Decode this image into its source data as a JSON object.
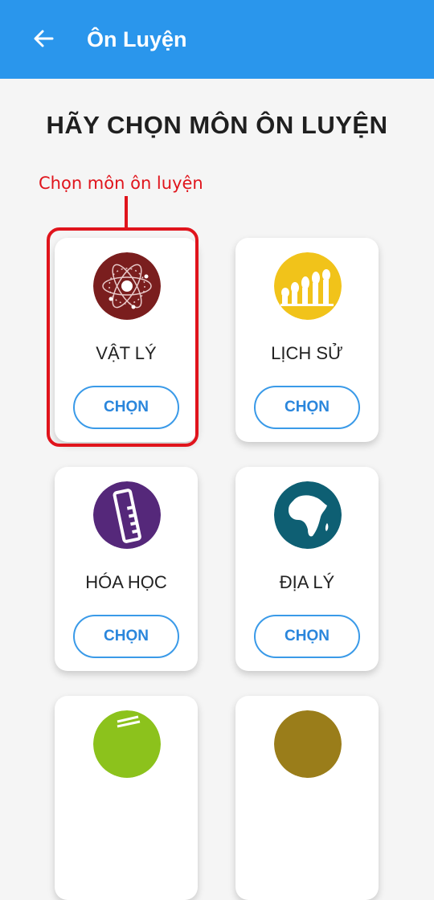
{
  "appbar": {
    "title": "Ôn Luyện",
    "back_icon": "arrow-left-icon"
  },
  "page": {
    "heading": "HÃY CHỌN MÔN ÔN LUYỆN"
  },
  "annotation": {
    "text": "Chọn môn ôn luyện",
    "color": "#e0141c"
  },
  "subjects": [
    {
      "name": "VẬT LÝ",
      "button": "CHỌN",
      "icon": "atom-icon",
      "color": "#7a1e1e"
    },
    {
      "name": "LỊCH SỬ",
      "button": "CHỌN",
      "icon": "human-evolution-icon",
      "color": "#f1c31a"
    },
    {
      "name": "HÓA HỌC",
      "button": "CHỌN",
      "icon": "test-tube-icon",
      "color": "#55287a"
    },
    {
      "name": "ĐỊA LÝ",
      "button": "CHỌN",
      "icon": "africa-map-icon",
      "color": "#0e5f73"
    },
    {
      "name": "",
      "button": "",
      "icon": "green-subject-icon",
      "color": "#8cc21c"
    },
    {
      "name": "",
      "button": "",
      "icon": "olive-subject-icon",
      "color": "#9a7d1a"
    }
  ],
  "colors": {
    "appbar": "#2a96ec",
    "button_border": "#3a9ae8",
    "button_text": "#2a86dc"
  }
}
